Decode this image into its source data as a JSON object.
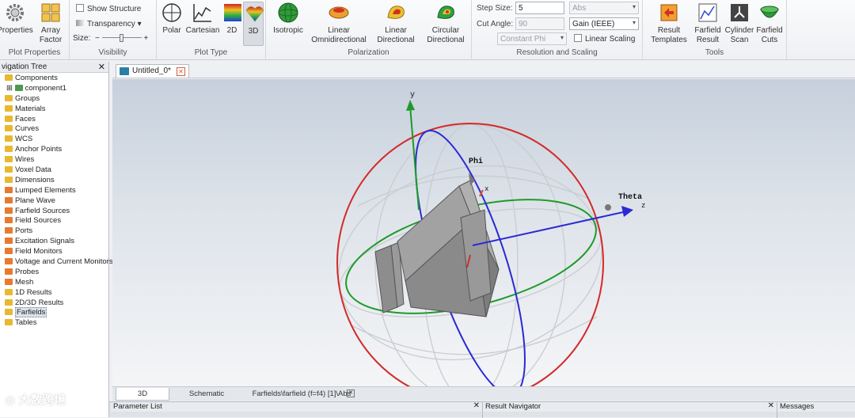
{
  "ribbon": {
    "plot_properties": {
      "buttons": [
        "Properties",
        "Array\nFactor"
      ],
      "group_label": "Plot Properties"
    },
    "visibility": {
      "show_structure": "Show Structure",
      "transparency": "Transparency",
      "size_label": "Size:",
      "group_label": "Visibility"
    },
    "plot_type": {
      "buttons": [
        "Polar",
        "Cartesian",
        "2D",
        "3D"
      ],
      "active": "3D",
      "group_label": "Plot Type"
    },
    "polarization": {
      "buttons": [
        "Isotropic",
        "Linear\nOmnidirectional",
        "Linear\nDirectional",
        "Circular\nDirectional"
      ],
      "group_label": "Polarization"
    },
    "resolution": {
      "step_size_label": "Step Size:",
      "step_size_value": "5",
      "cut_angle_label": "Cut Angle:",
      "cut_angle_value": "90",
      "abs_value": "Abs",
      "gain_value": "Gain (IEEE)",
      "constant_phi": "Constant Phi",
      "linear_scaling": "Linear Scaling",
      "group_label": "Resolution and Scaling"
    },
    "tools": {
      "buttons": [
        "Result\nTemplates",
        "Farfield\nResult",
        "Cylinder\nScan",
        "Farfield\nCuts"
      ],
      "group_label": "Tools"
    }
  },
  "nav": {
    "title": "vigation Tree",
    "items": [
      {
        "label": "Components",
        "color": "#e8b830"
      },
      {
        "label": "component1",
        "color": "#4c9a4c",
        "indent": true
      },
      {
        "label": "Groups",
        "color": "#e8b830"
      },
      {
        "label": "Materials",
        "color": "#e8b830"
      },
      {
        "label": "Faces",
        "color": "#e8b830"
      },
      {
        "label": "Curves",
        "color": "#e8b830"
      },
      {
        "label": "WCS",
        "color": "#e8b830"
      },
      {
        "label": "Anchor Points",
        "color": "#e8b830"
      },
      {
        "label": "Wires",
        "color": "#e8b830"
      },
      {
        "label": "Voxel Data",
        "color": "#e8b830"
      },
      {
        "label": "Dimensions",
        "color": "#e8b830"
      },
      {
        "label": "Lumped Elements",
        "color": "#e87a30"
      },
      {
        "label": "Plane Wave",
        "color": "#e87a30"
      },
      {
        "label": "Farfield Sources",
        "color": "#e87a30"
      },
      {
        "label": "Field Sources",
        "color": "#e87a30"
      },
      {
        "label": "Ports",
        "color": "#e87a30"
      },
      {
        "label": "Excitation Signals",
        "color": "#e87a30"
      },
      {
        "label": "Field Monitors",
        "color": "#e87a30"
      },
      {
        "label": "Voltage and Current Monitors",
        "color": "#e87a30"
      },
      {
        "label": "Probes",
        "color": "#e87a30"
      },
      {
        "label": "Mesh",
        "color": "#e87a30"
      },
      {
        "label": "1D Results",
        "color": "#e8b830"
      },
      {
        "label": "2D/3D Results",
        "color": "#e8b830"
      },
      {
        "label": "Farfields",
        "color": "#e8b830",
        "selected": true
      },
      {
        "label": "Tables",
        "color": "#e8b830"
      }
    ]
  },
  "document": {
    "tab_label": "Untitled_0*"
  },
  "viewport": {
    "axis_y": "y",
    "axis_z": "z",
    "axis_x": "x",
    "label_phi": "Phi",
    "label_theta": "Theta"
  },
  "bottom_tabs": [
    "3D",
    "Schematic",
    "Farfields\\farfield (f=f4) [1]\\Abs"
  ],
  "panels": [
    "Parameter List",
    "Result  Navigator",
    "Messages"
  ],
  "watermark": "大数跨境",
  "colors": {
    "accent": "#2a7fa8",
    "ring_red": "#d42a2a",
    "ring_green": "#1f9a2a",
    "ring_blue": "#2a2ad4"
  }
}
